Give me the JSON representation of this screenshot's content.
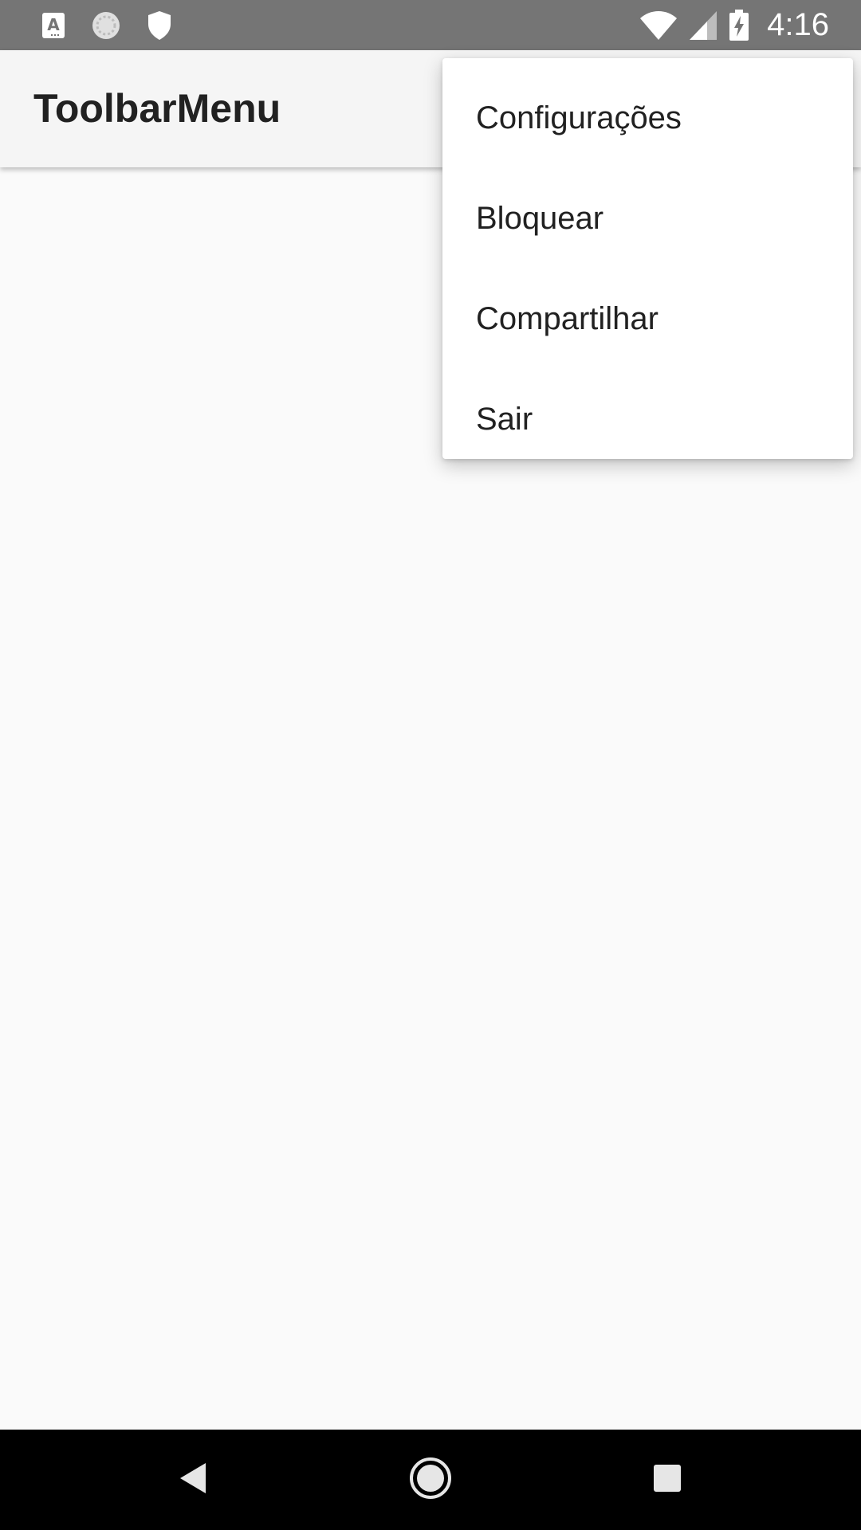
{
  "status_bar": {
    "time": "4:16",
    "icons_left": [
      "keyboard-a-icon",
      "sync-circle-icon",
      "shield-icon"
    ],
    "icons_right": [
      "wifi-icon",
      "cellular-signal-icon",
      "battery-charging-icon"
    ]
  },
  "toolbar": {
    "title": "ToolbarMenu"
  },
  "overflow_menu": {
    "items": [
      {
        "label": "Configurações"
      },
      {
        "label": "Bloquear"
      },
      {
        "label": "Compartilhar"
      },
      {
        "label": "Sair"
      }
    ]
  },
  "nav_bar": {
    "buttons": [
      "back-icon",
      "home-icon",
      "recents-icon"
    ]
  },
  "colors": {
    "status_bar": "#757575",
    "toolbar": "#f5f5f5",
    "background": "#fafafa",
    "menu": "#ffffff",
    "nav_bar": "#000000"
  }
}
